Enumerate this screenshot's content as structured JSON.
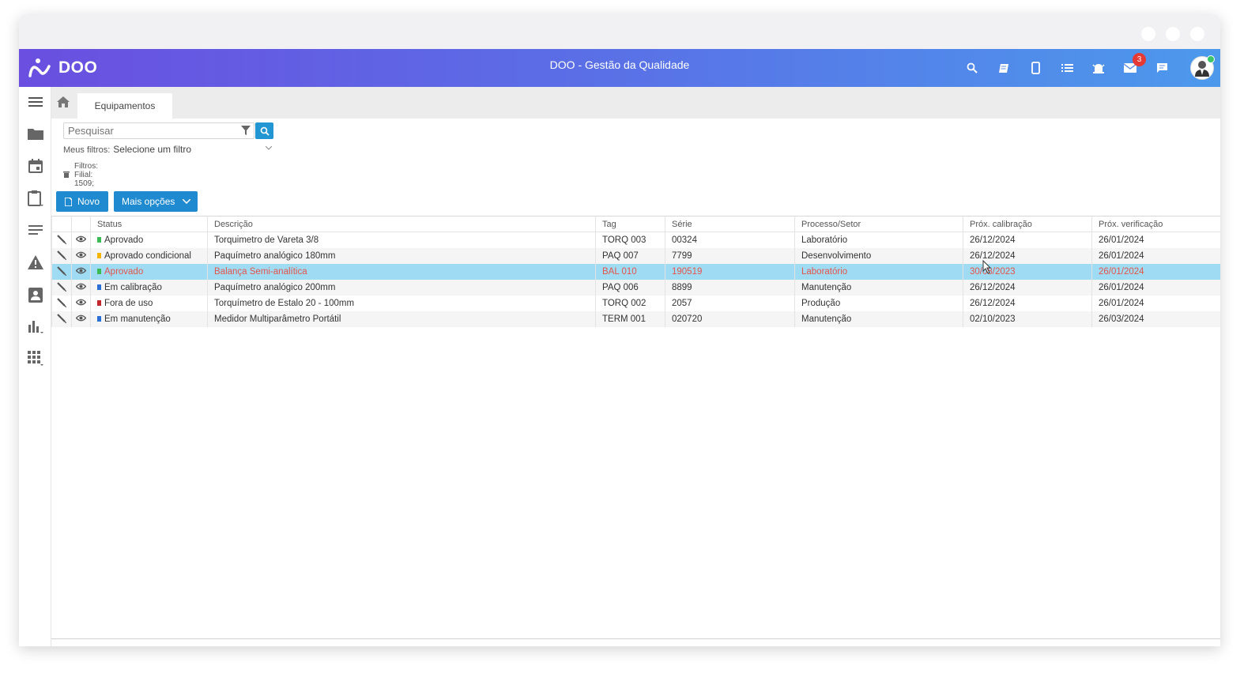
{
  "app": {
    "logo_text": "DOO",
    "title": "DOO - Gestão da Qualidade",
    "notifications_badge": "3"
  },
  "topbar_icons": [
    "search-icon",
    "book-icon",
    "mobile-icon",
    "list-icon",
    "bell-alarm-icon",
    "mail-icon",
    "chat-icon"
  ],
  "sidebar_icons": [
    "menu-icon",
    "folder-icon",
    "calendar-icon",
    "clipboard-icon",
    "lines-icon",
    "warning-icon",
    "contact-icon",
    "bar-chart-icon",
    "apps-grid-icon"
  ],
  "tabs": {
    "active_label": "Equipamentos"
  },
  "search": {
    "placeholder": "Pesquisar",
    "my_filters_label": "Meus filtros:",
    "my_filters_value": "Selecione um filtro",
    "active_filters_text": "Filtros: Filial: 1509;"
  },
  "toolbar": {
    "new_label": "Novo",
    "more_label": "Mais opções"
  },
  "table": {
    "columns": [
      "Status",
      "Descrição",
      "Tag",
      "Série",
      "Processo/Setor",
      "Próx. calibração",
      "Próx. verificação"
    ],
    "rows": [
      {
        "status": "Aprovado",
        "status_color": "#3cba54",
        "descricao": "Torquimetro de Vareta 3/8",
        "tag": "TORQ 003",
        "serie": "00324",
        "processo": "Laboratório",
        "calibracao": "26/12/2024",
        "verificacao": "26/01/2024"
      },
      {
        "status": "Aprovado condicional",
        "status_color": "#f4b400",
        "descricao": "Paquímetro analógico 180mm",
        "tag": "PAQ 007",
        "serie": "7799",
        "processo": "Desenvolvimento",
        "calibracao": "26/12/2024",
        "verificacao": "26/01/2024"
      },
      {
        "status": "Aprovado",
        "status_color": "#3cba54",
        "descricao": "Balança Semi-analítica",
        "tag": "BAL 010",
        "serie": "190519",
        "processo": "Laboratório",
        "calibracao": "30/08/2023",
        "verificacao": "26/01/2024"
      },
      {
        "status": "Em calibração",
        "status_color": "#2a6fd6",
        "descricao": "Paquímetro analógico 200mm",
        "tag": "PAQ 006",
        "serie": "8899",
        "processo": "Manutenção",
        "calibracao": "26/12/2024",
        "verificacao": "26/01/2024"
      },
      {
        "status": "Fora de uso",
        "status_color": "#c0282d",
        "descricao": "Torquímetro de Estalo 20 - 100mm",
        "tag": "TORQ 002",
        "serie": "2057",
        "processo": "Produção",
        "calibracao": "26/12/2024",
        "verificacao": "26/01/2024"
      },
      {
        "status": "Em manutenção",
        "status_color": "#2a6fd6",
        "descricao": "Medidor Multiparâmetro Portátil",
        "tag": "TERM 001",
        "serie": "020720",
        "processo": "Manutenção",
        "calibracao": "02/10/2023",
        "verificacao": "26/03/2024"
      }
    ],
    "selected_row": 2
  },
  "colors": {
    "accent": "#1f8ad0",
    "header_gradient_start": "#6a4fe0",
    "header_gradient_end": "#4c99ec",
    "selected_row_bg": "#9fdcf4",
    "selected_row_text": "#e5534b"
  }
}
